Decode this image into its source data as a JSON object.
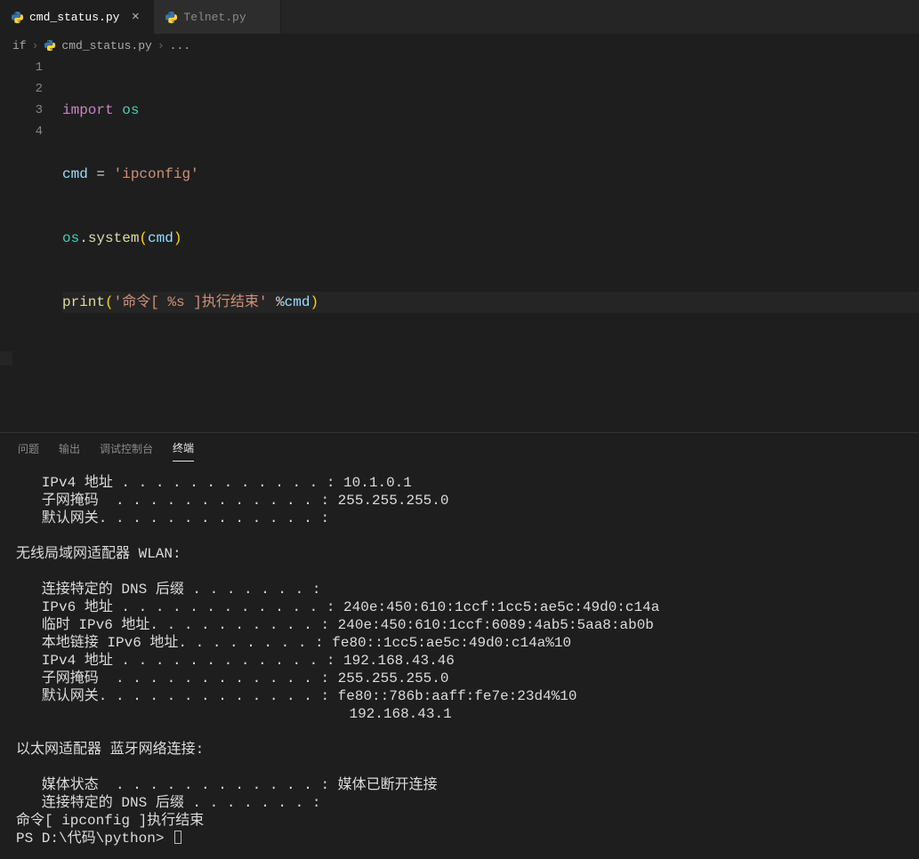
{
  "tabs": [
    {
      "label": "cmd_status.py",
      "active": true
    },
    {
      "label": "Telnet.py",
      "active": false
    }
  ],
  "breadcrumb": {
    "root": "if",
    "file": "cmd_status.py",
    "tail": "..."
  },
  "code": {
    "lines": [
      "1",
      "2",
      "3",
      "4"
    ],
    "l1": {
      "kw": "import",
      "mod": " os"
    },
    "l2": {
      "var": "cmd",
      "op": " = ",
      "str": "'ipconfig'"
    },
    "l3": {
      "mod": "os",
      "dot": ".",
      "fn": "system",
      "lp": "(",
      "arg": "cmd",
      "rp": ")"
    },
    "l4": {
      "fn": "print",
      "lp": "(",
      "str": "'命令[ %s ]执行结束'",
      "sp": " ",
      "pct": "%",
      "arg": "cmd",
      "rp": ")"
    }
  },
  "panel": {
    "tabs": [
      {
        "label": "问题",
        "active": false
      },
      {
        "label": "输出",
        "active": false
      },
      {
        "label": "调试控制台",
        "active": false
      },
      {
        "label": "终端",
        "active": true
      }
    ]
  },
  "terminal": {
    "lines": [
      "   IPv4 地址 . . . . . . . . . . . . : 10.1.0.1",
      "   子网掩码  . . . . . . . . . . . . : 255.255.255.0",
      "   默认网关. . . . . . . . . . . . . :",
      "",
      "无线局域网适配器 WLAN:",
      "",
      "   连接特定的 DNS 后缀 . . . . . . . :",
      "   IPv6 地址 . . . . . . . . . . . . : 240e:450:610:1ccf:1cc5:ae5c:49d0:c14a",
      "   临时 IPv6 地址. . . . . . . . . . : 240e:450:610:1ccf:6089:4ab5:5aa8:ab0b",
      "   本地链接 IPv6 地址. . . . . . . . : fe80::1cc5:ae5c:49d0:c14a%10",
      "   IPv4 地址 . . . . . . . . . . . . : 192.168.43.46",
      "   子网掩码  . . . . . . . . . . . . : 255.255.255.0",
      "   默认网关. . . . . . . . . . . . . : fe80::786b:aaff:fe7e:23d4%10",
      "                                       192.168.43.1",
      "",
      "以太网适配器 蓝牙网络连接:",
      "",
      "   媒体状态  . . . . . . . . . . . . : 媒体已断开连接",
      "   连接特定的 DNS 后缀 . . . . . . . :",
      "命令[ ipconfig ]执行结束"
    ],
    "prompt": "PS D:\\代码\\python> "
  }
}
